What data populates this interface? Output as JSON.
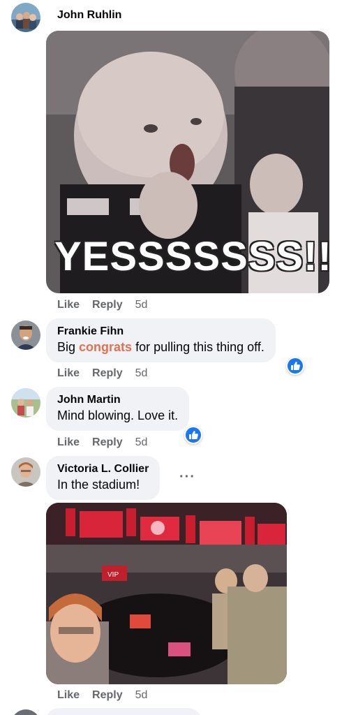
{
  "comments": [
    {
      "author": "John Ruhlin",
      "media": {
        "caption": "YESSSSSSS!!"
      },
      "actions": {
        "like": "Like",
        "reply": "Reply",
        "time": "5d"
      }
    },
    {
      "author": "Frankie Fihn",
      "text_before": "Big ",
      "highlight": "congrats",
      "text_after": " for pulling this thing off.",
      "reaction": "like-reaction-icon",
      "actions": {
        "like": "Like",
        "reply": "Reply",
        "time": "5d"
      }
    },
    {
      "author": "John Martin",
      "text": "Mind blowing. Love it.",
      "reaction": "like-reaction-icon",
      "actions": {
        "like": "Like",
        "reply": "Reply",
        "time": "5d"
      }
    },
    {
      "author": "Victoria L. Collier",
      "text": "In the stadium!",
      "more": "···",
      "media": {
        "badge": "VIP"
      },
      "actions": {
        "like": "Like",
        "reply": "Reply",
        "time": "5d"
      }
    }
  ],
  "colors": {
    "accent_blue": "#1877f2",
    "highlight": "#e07252",
    "bubble": "#f0f2f5",
    "meta_gray": "#65676b"
  }
}
